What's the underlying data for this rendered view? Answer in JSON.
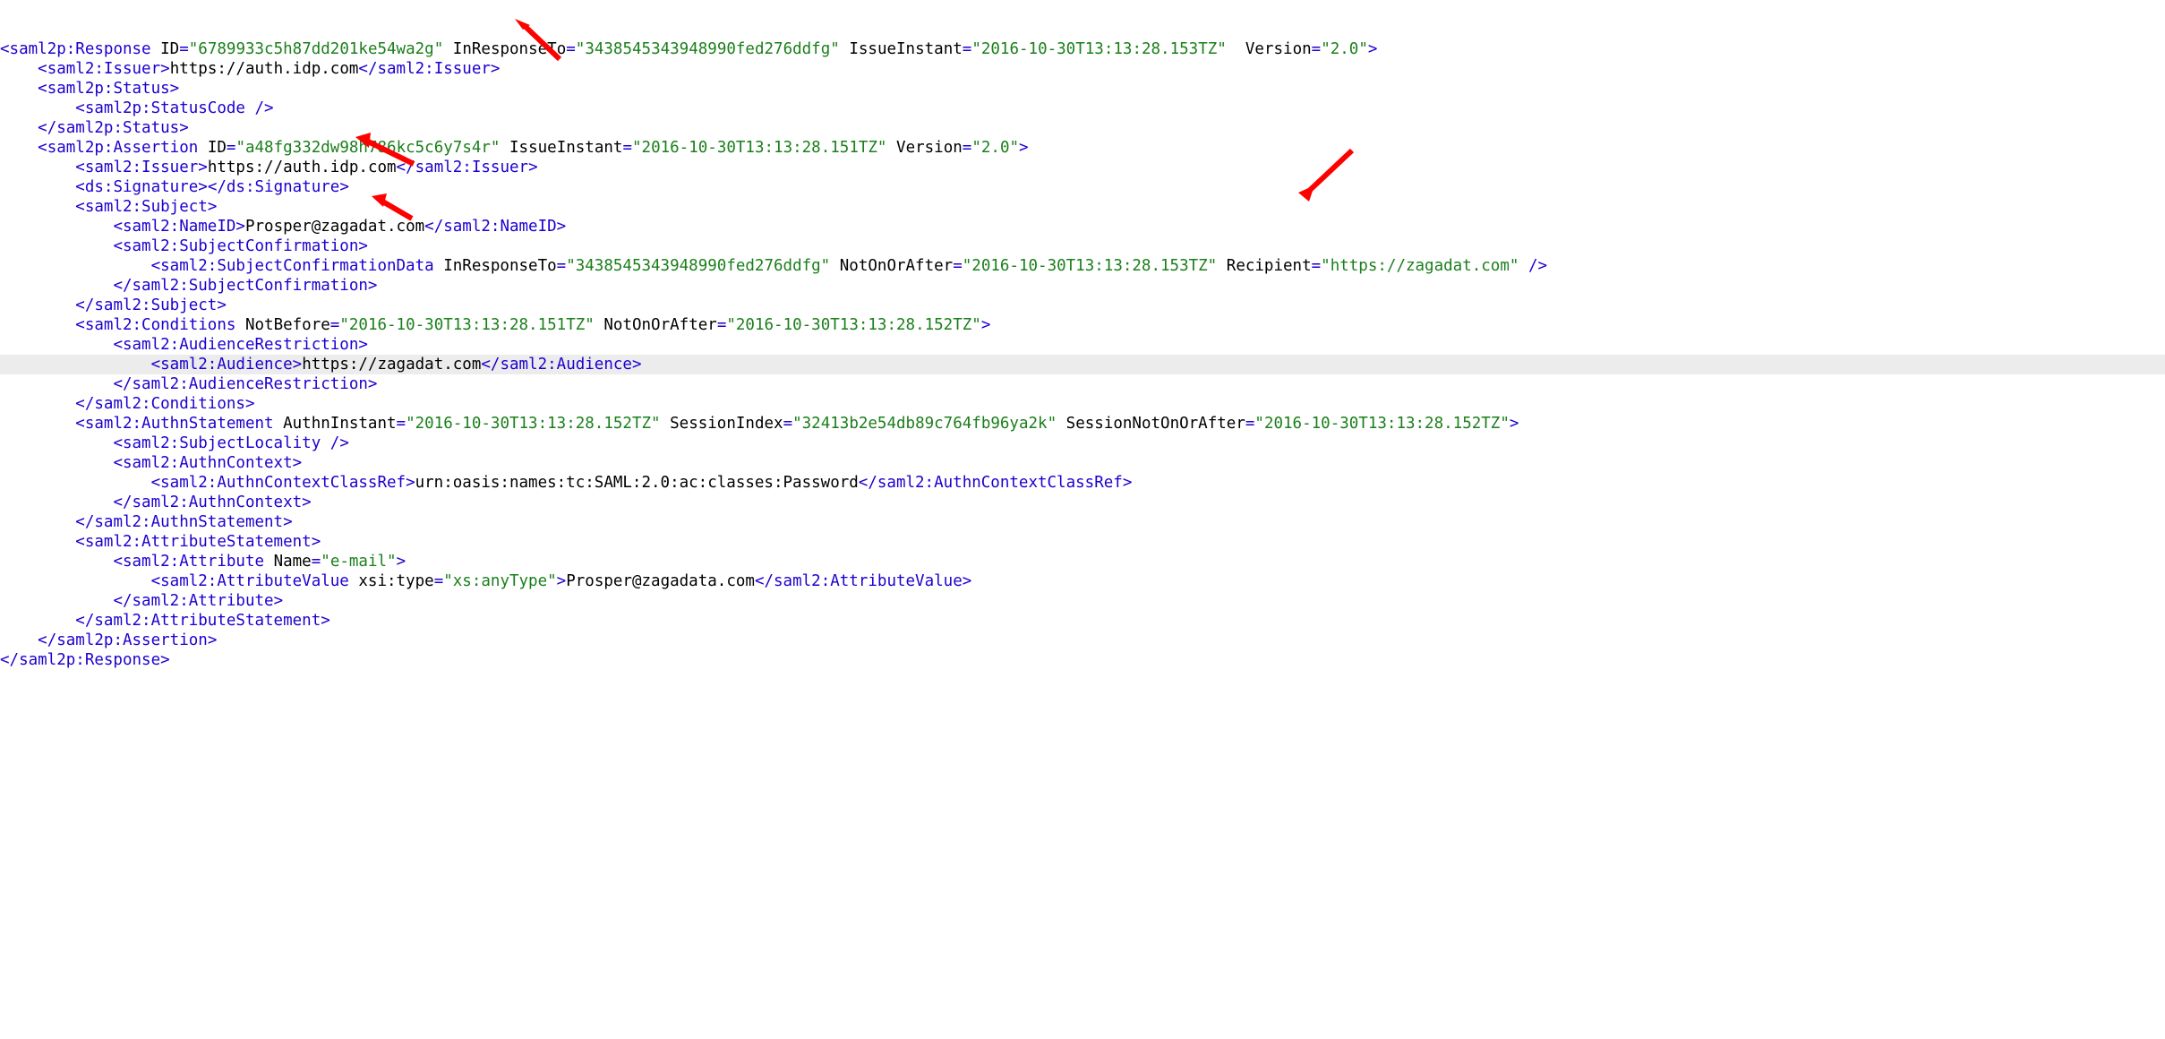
{
  "xml": {
    "response": {
      "tagOpen": "saml2p:Response",
      "idLabel": "ID",
      "id": "\"6789933c5h87dd201ke54wa2g\"",
      "inRespLabel": "InResponseTo",
      "inResp": "\"3438545343948990fed276ddfg\"",
      "issueLabel": "IssueInstant",
      "issue": "\"2016-10-30T13:13:28.153TZ\"",
      "verLabel": "Version",
      "ver": "\"2.0\"",
      "issuerTag": "saml2:Issuer",
      "issuerText": "https://auth.idp.com",
      "statusTag": "saml2p:Status",
      "statusCodeTag": "saml2p:StatusCode",
      "assertion": {
        "tag": "saml2p:Assertion",
        "idLabel": "ID",
        "id": "\"a48fg332dw98h786kc5c6y7s4r\"",
        "issueLabel": "IssueInstant",
        "issue": "\"2016-10-30T13:13:28.151TZ\"",
        "verLabel": "Version",
        "ver": "\"2.0\"",
        "issuerTag": "saml2:Issuer",
        "issuerText": "https://auth.idp.com",
        "sigTag": "ds:Signature",
        "subjectTag": "saml2:Subject",
        "nameIdTag": "saml2:NameID",
        "nameIdText": "Prosper@zagadat.com",
        "subjConfTag": "saml2:SubjectConfirmation",
        "subjConfDataTag": "saml2:SubjectConfirmationData",
        "scd_inRespLabel": "InResponseTo",
        "scd_inResp": "\"3438545343948990fed276ddfg\"",
        "scd_notAfterLabel": "NotOnOrAfter",
        "scd_notAfter": "\"2016-10-30T13:13:28.153TZ\"",
        "scd_recipLabel": "Recipient",
        "scd_recip": "\"https://zagadat.com\"",
        "scd_close": " />",
        "cond": {
          "tag": "saml2:Conditions",
          "nbLabel": "NotBefore",
          "nb": "\"2016-10-30T13:13:28.151TZ\"",
          "naLabel": "NotOnOrAfter",
          "na": "\"2016-10-30T13:13:28.152TZ\"",
          "audRestTag": "saml2:AudienceRestriction",
          "audTag": "saml2:Audience",
          "audText": "https://zagadat.com"
        },
        "authn": {
          "tag": "saml2:AuthnStatement",
          "aiLabel": "AuthnInstant",
          "ai": "\"2016-10-30T13:13:28.152TZ\"",
          "siLabel": "SessionIndex",
          "si": "\"32413b2e54db89c764fb96ya2k\"",
          "snLabel": "SessionNotOnOrAfter",
          "sn": "\"2016-10-30T13:13:28.152TZ\"",
          "subjLocTag": "saml2:SubjectLocality",
          "ctxTag": "saml2:AuthnContext",
          "ctxRefTag": "saml2:AuthnContextClassRef",
          "ctxRefText": "urn:oasis:names:tc:SAML:2.0:ac:classes:Password"
        },
        "attrStmt": {
          "tag": "saml2:AttributeStatement",
          "attrTag": "saml2:Attribute",
          "nameLabel": "Name",
          "name": "\"e-mail\"",
          "attrValTag": "saml2:AttributeValue",
          "typeLabel": "xsi:type",
          "type": "\"xs:anyType\"",
          "valText": "Prosper@zagadata.com"
        }
      }
    }
  }
}
